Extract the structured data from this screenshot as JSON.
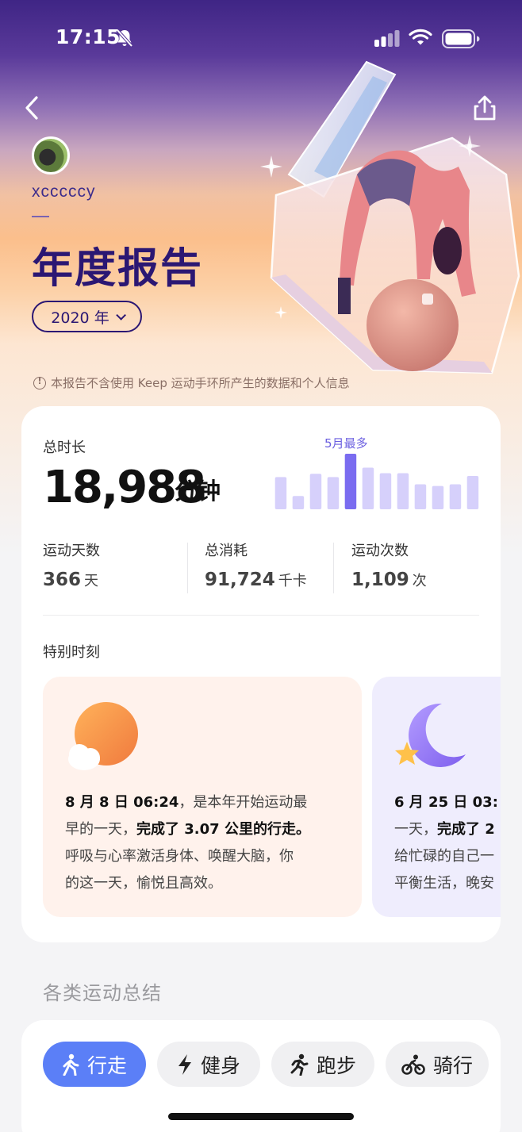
{
  "status_bar": {
    "time": "17:15"
  },
  "profile": {
    "username": "xcccccy"
  },
  "report": {
    "title": "年度报告",
    "year_label": "2020 年"
  },
  "notice": "本报告不含使用 Keep 运动手环所产生的数据和个人信息",
  "summary": {
    "total_label": "总时长",
    "total_value": "18,988",
    "total_unit": "分钟",
    "max_month_label": "5月最多",
    "monthly_bars": [
      0.58,
      0.24,
      0.64,
      0.58,
      1.0,
      0.75,
      0.65,
      0.65,
      0.45,
      0.42,
      0.45,
      0.6
    ],
    "highlight_index": 4,
    "stats": [
      {
        "label": "运动天数",
        "value": "366",
        "unit": "天"
      },
      {
        "label": "总消耗",
        "value": "91,724",
        "unit": "千卡"
      },
      {
        "label": "运动次数",
        "value": "1,109",
        "unit": "次"
      }
    ]
  },
  "special": {
    "label": "特别时刻",
    "moments": [
      {
        "icon": "sun-icon",
        "date": "8 月 8 日 06:24",
        "line1_rest": "，是本年开始运动最",
        "line2_start": "早的一天，",
        "line2_bold": "完成了 3.07 公里的行走。",
        "line3": "呼吸与心率激活身体、唤醒大脑，你",
        "line4": "的这一天，愉悦且高效。"
      },
      {
        "icon": "moon-icon",
        "date": "6 月 25 日 03:",
        "line2_start": "一天，",
        "line2_bold": "完成了 2",
        "line3": "给忙碌的自己一",
        "line4": "平衡生活，晚安"
      }
    ]
  },
  "categories": {
    "title": "各类运动总结",
    "tabs": [
      {
        "label": "行走",
        "icon": "walk-icon",
        "active": true
      },
      {
        "label": "健身",
        "icon": "bolt-icon",
        "active": false
      },
      {
        "label": "跑步",
        "icon": "run-icon",
        "active": false
      },
      {
        "label": "骑行",
        "icon": "bike-icon",
        "active": false
      }
    ]
  },
  "colors": {
    "accent": "#5b7ff7",
    "title": "#2b1773",
    "bar": "#d6d0fb",
    "bar_highlight": "#7a6cf0"
  }
}
